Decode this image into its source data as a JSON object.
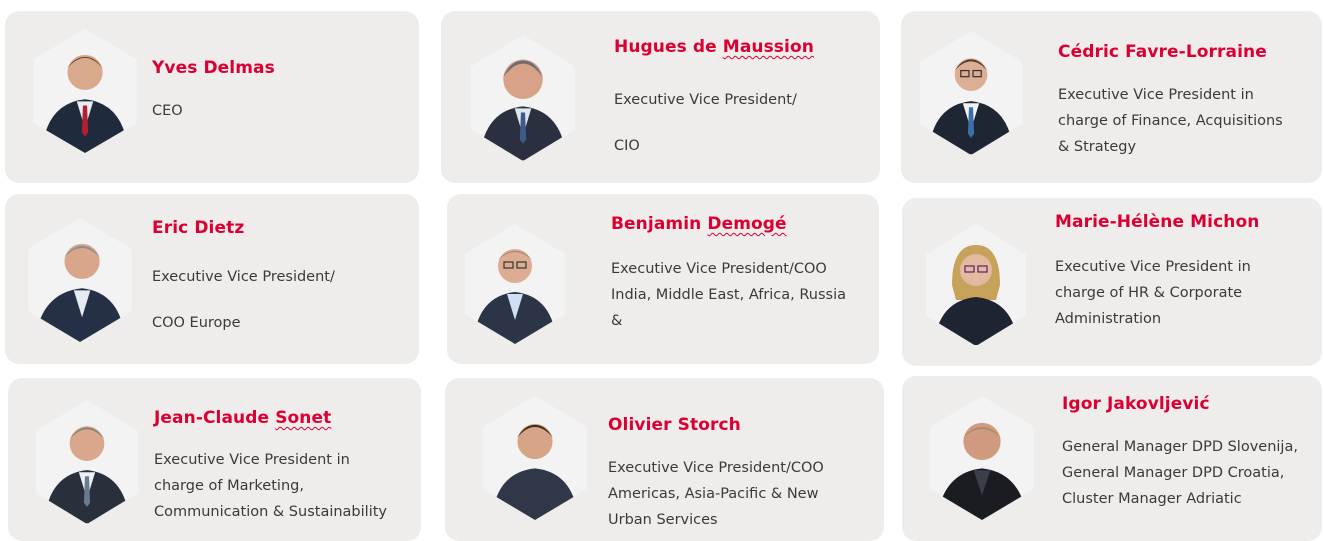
{
  "colors": {
    "accent": "#dc0032",
    "card": "#efedeb",
    "text": "#3a3a3a"
  },
  "people": [
    {
      "first": "Yves Delmas",
      "flagged": "",
      "roles": [
        "CEO"
      ],
      "photo": "portrait-photo"
    },
    {
      "first": "Hugues de ",
      "flagged": "Maussion",
      "roles": [
        "Executive Vice President/",
        "CIO"
      ],
      "photo": "portrait-photo"
    },
    {
      "first": "Cédric Favre-Lorraine",
      "flagged": "",
      "roles": [
        "Executive Vice President in",
        "charge of Finance, Acquisitions",
        "& Strategy"
      ],
      "photo": "portrait-photo"
    },
    {
      "first": "Eric Dietz",
      "flagged": "",
      "roles": [
        "Executive Vice President/",
        "COO Europe"
      ],
      "photo": "portrait-photo"
    },
    {
      "first": "Benjamin ",
      "flagged": "Demogé",
      "roles": [
        "Executive Vice President/COO",
        "India, Middle East, Africa, Russia",
        "&"
      ],
      "photo": "portrait-photo"
    },
    {
      "first": "Marie-Hélène Michon",
      "flagged": "",
      "roles": [
        "Executive Vice President in",
        "charge of HR & Corporate",
        "Administration"
      ],
      "photo": "portrait-photo"
    },
    {
      "first": "Jean-Claude ",
      "flagged": "Sonet",
      "roles": [
        "Executive Vice President in",
        "charge of Marketing,",
        "Communication & Sustainability"
      ],
      "photo": "portrait-photo"
    },
    {
      "first": "Olivier Storch",
      "flagged": "",
      "roles": [
        "Executive Vice President/COO",
        "Americas, Asia-Pacific & New",
        "Urban Services"
      ],
      "photo": "portrait-photo"
    },
    {
      "first": "Igor Jakovljević",
      "flagged": "",
      "roles": [
        "General Manager DPD Slovenija,",
        "General Manager DPD Croatia,",
        "Cluster Manager Adriatic"
      ],
      "photo": "portrait-photo"
    }
  ]
}
